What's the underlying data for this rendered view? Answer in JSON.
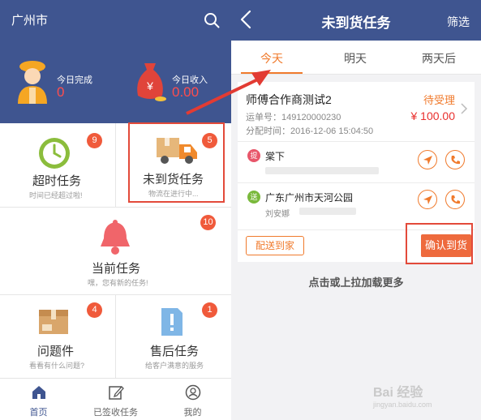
{
  "left": {
    "city": "广州市",
    "stats": [
      {
        "label": "今日完成",
        "value": "0"
      },
      {
        "label": "今日收入",
        "value": "0.00"
      }
    ],
    "bag_symbol": "¥",
    "cells": [
      {
        "title": "超时任务",
        "subtitle": "时间已经超过啦!",
        "badge": "9"
      },
      {
        "title": "未到货任务",
        "subtitle": "物流在进行中...",
        "badge": "5"
      },
      {
        "title": "当前任务",
        "subtitle": "嘿，您有新的任务!",
        "badge": "10"
      },
      {
        "title": "问题件",
        "subtitle": "看看有什么问题?",
        "badge": "4"
      },
      {
        "title": "售后任务",
        "subtitle": "给客户满意的服务",
        "badge": "1"
      }
    ],
    "tabs": [
      {
        "label": "首页"
      },
      {
        "label": "已签收任务"
      },
      {
        "label": "我的"
      }
    ]
  },
  "right": {
    "title": "未到货任务",
    "filter": "筛选",
    "tabs": [
      {
        "label": "今天"
      },
      {
        "label": "明天"
      },
      {
        "label": "两天后"
      }
    ],
    "card": {
      "name": "师傅合作商测试2",
      "status": "待受理",
      "order_no": "运单号：149120000230",
      "dispatch_time": "分配时间：2016-12-06 15:04:50",
      "price": "¥ 100.00",
      "pickup_tag": "提",
      "pickup_name": "棠下",
      "delivery_tag": "送",
      "delivery_name": "广东广州市天河公园",
      "delivery_contact": "刘安娜",
      "btn_deliver": "配送到家",
      "btn_confirm": "确认到货"
    },
    "load_more": "点击或上拉加载更多"
  },
  "watermark": "Bai 经验",
  "watermark_sub": "jingyan.baidu.com",
  "colors": {
    "header_blue": "#3f5590",
    "accent_orange": "#f07a2c",
    "badge_red": "#f05a3b",
    "highlight_red": "#e34a3a"
  }
}
